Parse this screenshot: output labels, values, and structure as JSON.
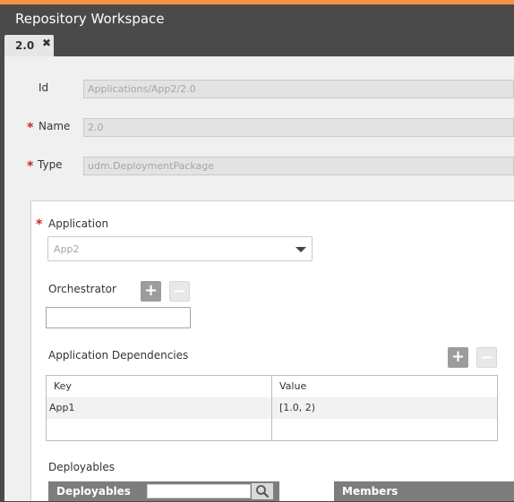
{
  "window": {
    "title": "Repository Workspace"
  },
  "tabs": [
    {
      "label": "2.0",
      "close_icon": "close-icon"
    }
  ],
  "form": {
    "id_label": "Id",
    "id_value": "Applications/App2/2.0",
    "name_label": "Name",
    "name_value": "2.0",
    "type_label": "Type",
    "type_value": "udm.DeploymentPackage",
    "required_marker": "*"
  },
  "details": {
    "application_label": "Application",
    "application_value": "App2",
    "orchestrator_label": "Orchestrator",
    "orchestrator_value": "",
    "dependencies_label": "Application Dependencies",
    "dependencies_columns": [
      "Key",
      "Value"
    ],
    "dependencies_rows": [
      {
        "key": "App1",
        "value": "[1.0, 2)"
      }
    ],
    "deployables_label": "Deployables",
    "deployables_panel_title": "Deployables",
    "members_panel_title": "Members"
  },
  "icons": {
    "add": "plus-icon",
    "remove": "minus-icon",
    "search": "search-icon",
    "dropdown": "chevron-down-icon"
  },
  "colors": {
    "accent": "#f39545",
    "required": "#cc2222",
    "header_bg": "#4a4a4a"
  }
}
